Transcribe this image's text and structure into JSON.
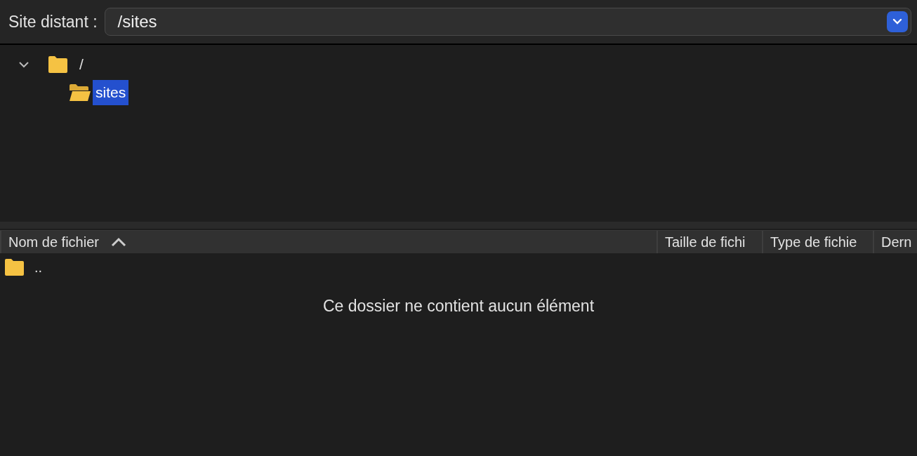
{
  "remote_site": {
    "label": "Site distant :",
    "value": "/sites"
  },
  "tree": [
    {
      "label": "/",
      "expanded": true,
      "selected": false,
      "children": [
        {
          "label": "sites",
          "selected": true
        }
      ]
    }
  ],
  "file_list": {
    "columns": [
      {
        "label": "Nom de fichier",
        "sorted": true
      },
      {
        "label": "Taille de fichi",
        "sorted": false
      },
      {
        "label": "Type de fichie",
        "sorted": false
      },
      {
        "label": "Dern",
        "sorted": false
      }
    ],
    "rows": [
      {
        "name": ".."
      }
    ],
    "empty_message": "Ce dossier ne contient aucun élément"
  }
}
